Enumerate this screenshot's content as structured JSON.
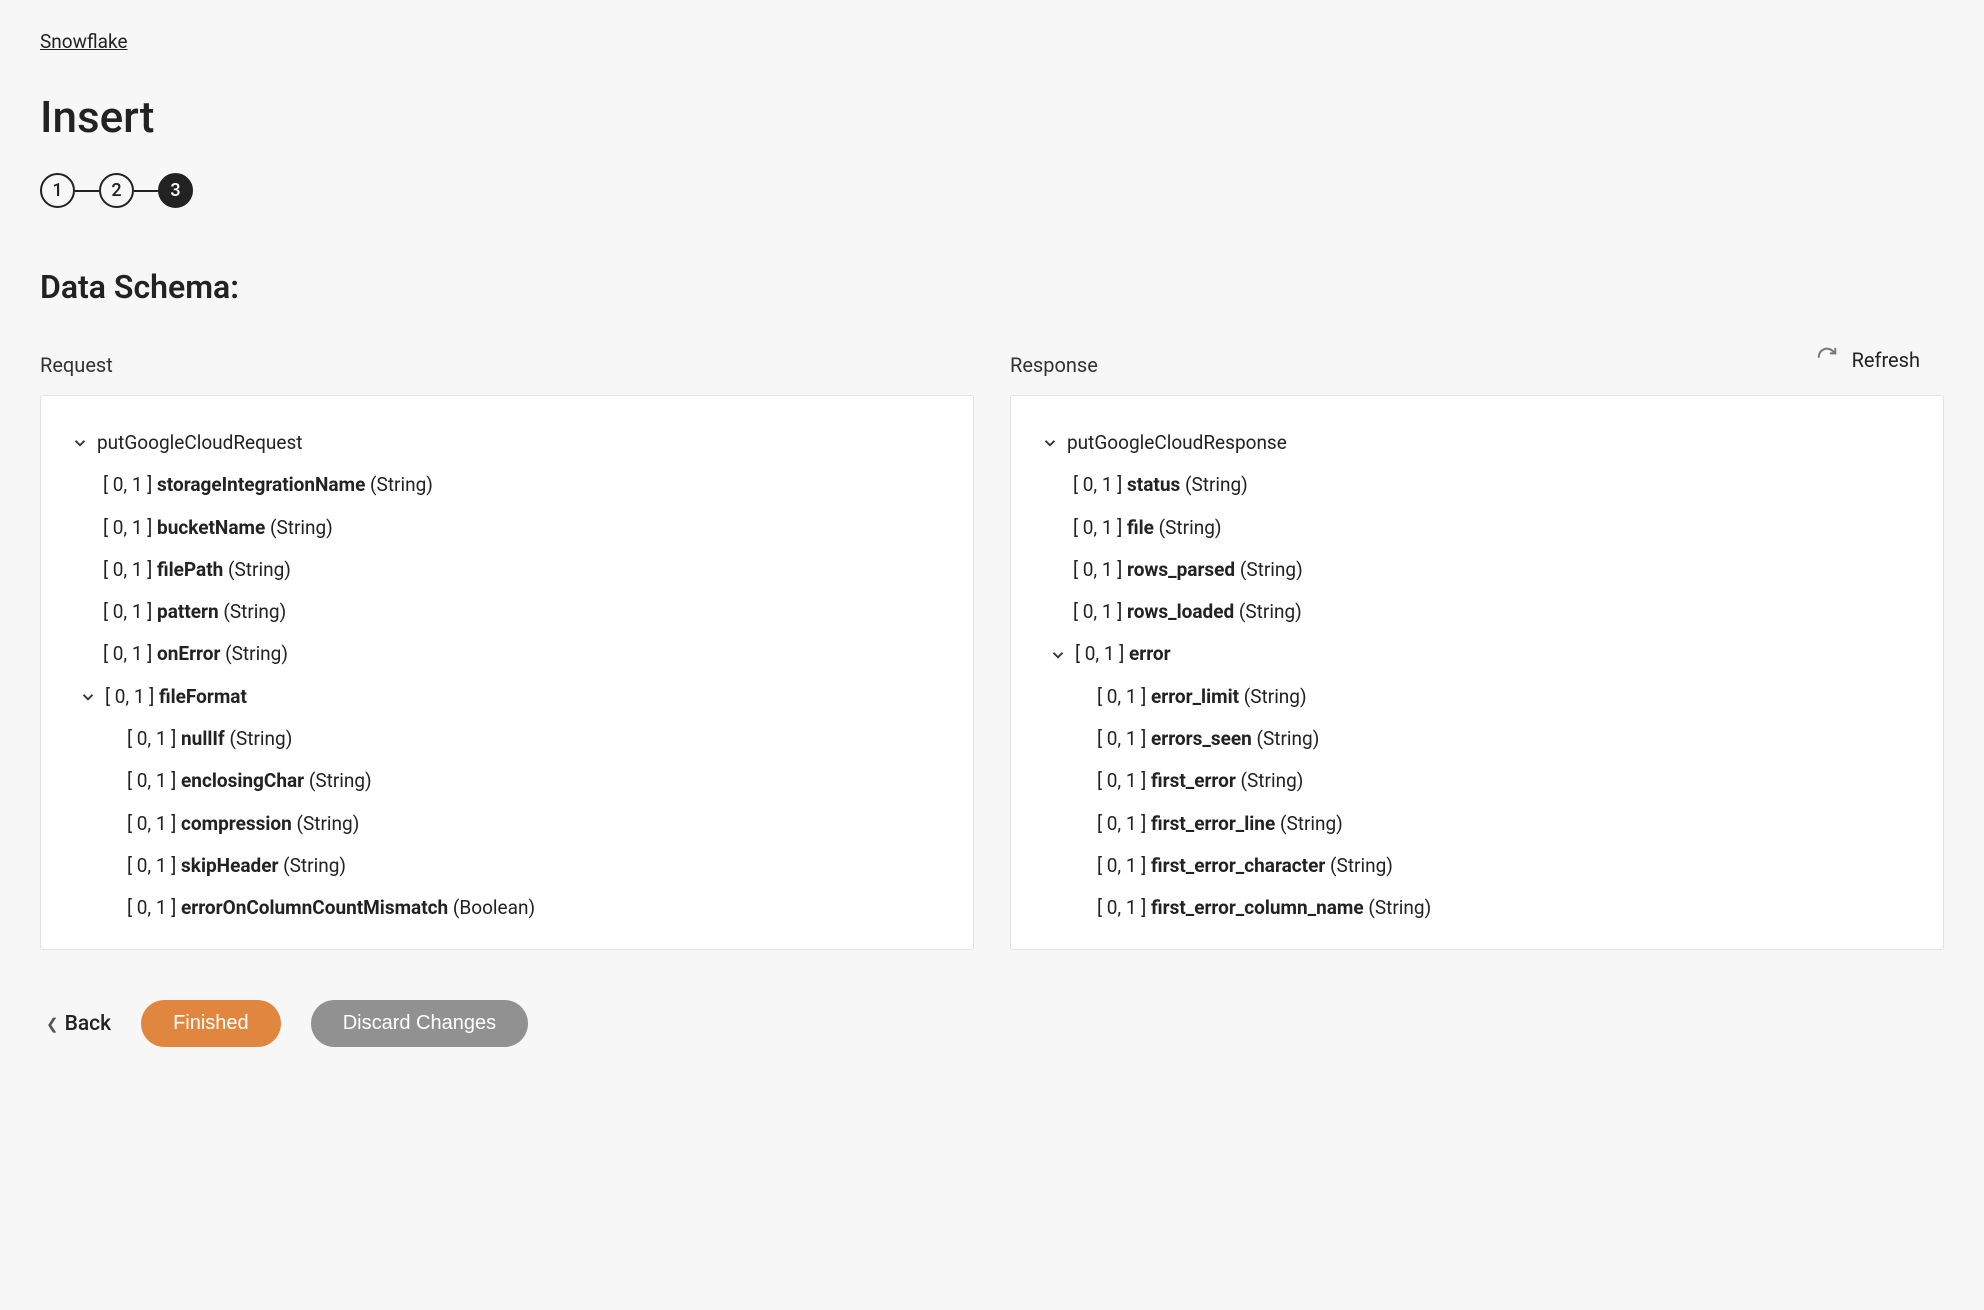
{
  "breadcrumb": "Snowflake",
  "page_title": "Insert",
  "stepper": {
    "steps": [
      "1",
      "2",
      "3"
    ],
    "active_index": 2
  },
  "section_title": "Data Schema:",
  "refresh_label": "Refresh",
  "request": {
    "header": "Request",
    "root": "putGoogleCloudRequest",
    "fields": [
      {
        "card": "[ 0, 1 ]",
        "name": "storageIntegrationName",
        "type": "(String)"
      },
      {
        "card": "[ 0, 1 ]",
        "name": "bucketName",
        "type": "(String)"
      },
      {
        "card": "[ 0, 1 ]",
        "name": "filePath",
        "type": "(String)"
      },
      {
        "card": "[ 0, 1 ]",
        "name": "pattern",
        "type": "(String)"
      },
      {
        "card": "[ 0, 1 ]",
        "name": "onError",
        "type": "(String)"
      }
    ],
    "fileFormat": {
      "card": "[ 0, 1 ]",
      "name": "fileFormat",
      "children": [
        {
          "card": "[ 0, 1 ]",
          "name": "nullIf",
          "type": "(String)"
        },
        {
          "card": "[ 0, 1 ]",
          "name": "enclosingChar",
          "type": "(String)"
        },
        {
          "card": "[ 0, 1 ]",
          "name": "compression",
          "type": "(String)"
        },
        {
          "card": "[ 0, 1 ]",
          "name": "skipHeader",
          "type": "(String)"
        },
        {
          "card": "[ 0, 1 ]",
          "name": "errorOnColumnCountMismatch",
          "type": "(Boolean)"
        }
      ]
    }
  },
  "response": {
    "header": "Response",
    "root": "putGoogleCloudResponse",
    "fields": [
      {
        "card": "[ 0, 1 ]",
        "name": "status",
        "type": "(String)"
      },
      {
        "card": "[ 0, 1 ]",
        "name": "file",
        "type": "(String)"
      },
      {
        "card": "[ 0, 1 ]",
        "name": "rows_parsed",
        "type": "(String)"
      },
      {
        "card": "[ 0, 1 ]",
        "name": "rows_loaded",
        "type": "(String)"
      }
    ],
    "error": {
      "card": "[ 0, 1 ]",
      "name": "error",
      "children": [
        {
          "card": "[ 0, 1 ]",
          "name": "error_limit",
          "type": "(String)"
        },
        {
          "card": "[ 0, 1 ]",
          "name": "errors_seen",
          "type": "(String)"
        },
        {
          "card": "[ 0, 1 ]",
          "name": "first_error",
          "type": "(String)"
        },
        {
          "card": "[ 0, 1 ]",
          "name": "first_error_line",
          "type": "(String)"
        },
        {
          "card": "[ 0, 1 ]",
          "name": "first_error_character",
          "type": "(String)"
        },
        {
          "card": "[ 0, 1 ]",
          "name": "first_error_column_name",
          "type": "(String)"
        }
      ]
    }
  },
  "footer": {
    "back": "Back",
    "finished": "Finished",
    "discard": "Discard Changes"
  }
}
